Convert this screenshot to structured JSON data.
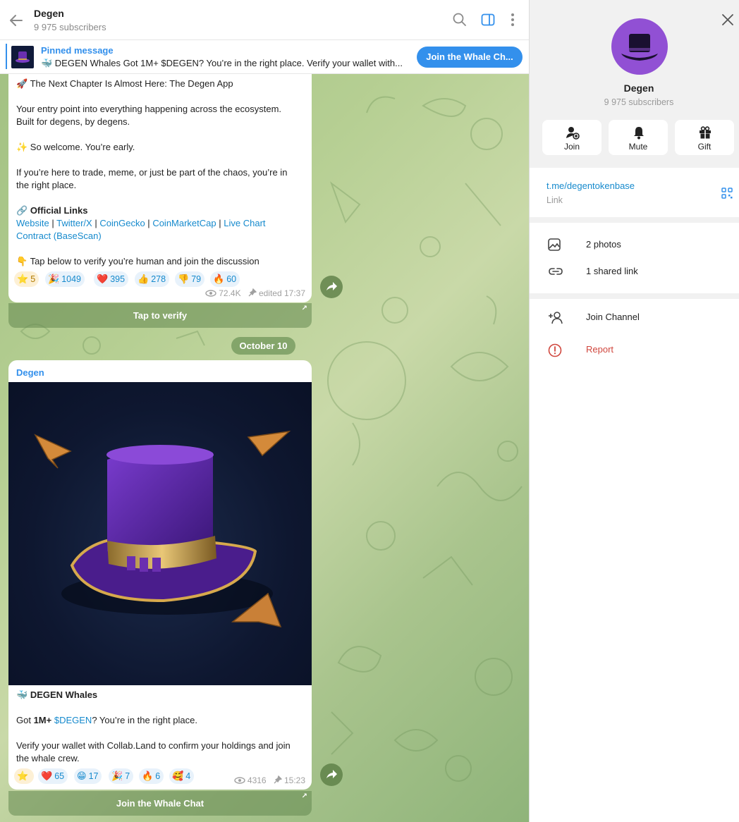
{
  "header": {
    "title": "Degen",
    "subtitle": "9 975 subscribers"
  },
  "pinned": {
    "label": "Pinned message",
    "text": "🐳 DEGEN Whales  Got 1M+ $DEGEN? You’re in the right place.  Verify your wallet with...",
    "button_label": "Join the Whale Ch..."
  },
  "message1": {
    "line1": "🚀 The Next Chapter Is Almost Here: The Degen App",
    "line2": "Your entry point into everything happening across the ecosystem.",
    "line3": "Built for degens, by degens.",
    "line4": "✨ So welcome. You’re early.",
    "line5": "If you’re here to trade, meme, or just be part of the chaos, you’re in",
    "line6": "the right place.",
    "links_heading_icon": "🔗",
    "links_heading": "Official Links",
    "links": [
      "Website",
      "Twitter/X",
      "CoinGecko",
      "CoinMarketCap",
      "Live Chart",
      "Contract (BaseScan)"
    ],
    "separator": "|",
    "cta": "👇 Tap below to verify you’re human and join the discussion",
    "reactions": [
      {
        "emoji": "⭐",
        "count": "5"
      },
      {
        "emoji": "🎉",
        "count": "1049"
      },
      {
        "emoji": "❤️",
        "count": "395"
      },
      {
        "emoji": "👍",
        "count": "278"
      },
      {
        "emoji": "👎",
        "count": "79"
      },
      {
        "emoji": "🔥",
        "count": "60"
      }
    ],
    "views": "72.4K",
    "edited": "edited 17:37",
    "button_label": "Tap to verify"
  },
  "date_separator": "October 10",
  "message2": {
    "author": "Degen",
    "title_icon": "🐳",
    "title": "DEGEN Whales",
    "line1_pre": "Got ",
    "line1_bold": "1M+",
    "line1_link": "$DEGEN",
    "line1_post": "? You’re in the right place.",
    "line2": "Verify your wallet with Collab.Land to confirm your holdings and join",
    "line3": "the whale crew.",
    "reactions": [
      {
        "emoji": "⭐",
        "count": ""
      },
      {
        "emoji": "❤️",
        "count": "65"
      },
      {
        "emoji": "😁",
        "count": "17"
      },
      {
        "emoji": "🎉",
        "count": "7"
      },
      {
        "emoji": "🔥",
        "count": "6"
      },
      {
        "emoji": "🥰",
        "count": "4"
      }
    ],
    "views": "4316",
    "time": "15:23",
    "button_label": "Join the Whale Chat"
  },
  "panel": {
    "name": "Degen",
    "subtitle": "9 975 subscribers",
    "actions": [
      {
        "label": "Join",
        "icon": "add-user-icon"
      },
      {
        "label": "Mute",
        "icon": "bell-icon"
      },
      {
        "label": "Gift",
        "icon": "gift-icon"
      }
    ],
    "link_value": "t.me/degentokenbase",
    "link_label": "Link",
    "media": [
      {
        "label": "2 photos",
        "icon": "photo-icon"
      },
      {
        "label": "1 shared link",
        "icon": "link-icon"
      }
    ],
    "join_channel": "Join Channel",
    "report": "Report"
  },
  "colors": {
    "accent": "#3390ec",
    "link": "#168acd",
    "avatar": "#9150d4",
    "report": "#d0473e"
  }
}
